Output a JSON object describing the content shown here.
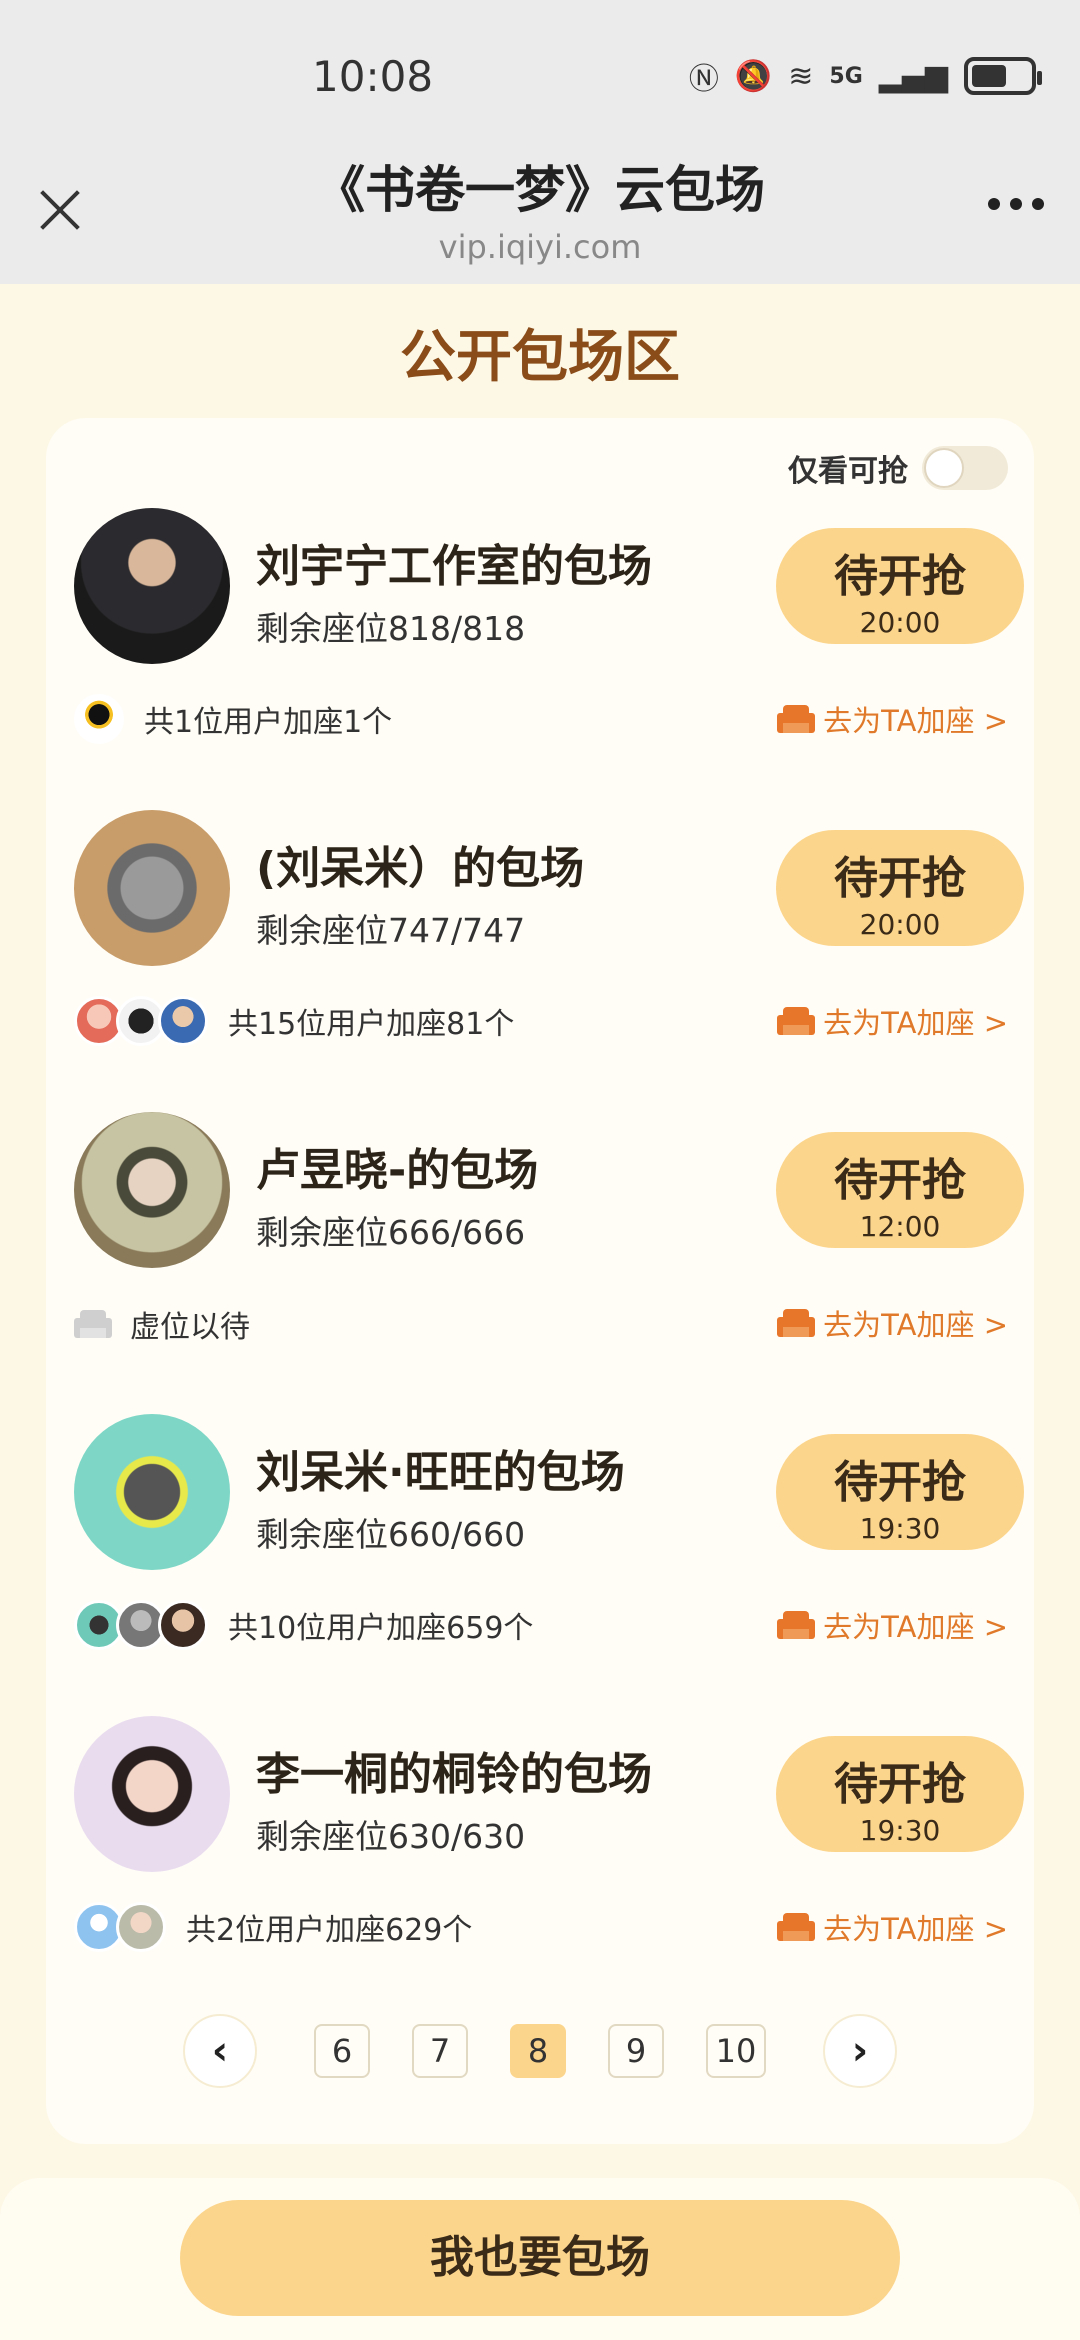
{
  "status_bar": {
    "time": "10:08",
    "signal_label": "5G"
  },
  "header": {
    "title": "《书卷一梦》云包场",
    "url": "vip.iqiyi.com"
  },
  "section_title": "公开包场区",
  "filter": {
    "label": "仅看可抢",
    "toggle_on": false
  },
  "entries": [
    {
      "title": "刘宇宁工作室的包场",
      "seats": "剩余座位818/818",
      "button": "待开抢",
      "time": "20:00",
      "users": "共1位用户加座1个",
      "seat_link": "去为TA加座 >"
    },
    {
      "title": "(刘呆米）的包场",
      "seats": "剩余座位747/747",
      "button": "待开抢",
      "time": "20:00",
      "users": "共15位用户加座81个",
      "seat_link": "去为TA加座 >"
    },
    {
      "title": "卢昱晓-的包场",
      "seats": "剩余座位666/666",
      "button": "待开抢",
      "time": "12:00",
      "users": "虚位以待",
      "seat_link": "去为TA加座 >"
    },
    {
      "title": "刘呆米·旺旺的包场",
      "seats": "剩余座位660/660",
      "button": "待开抢",
      "time": "19:30",
      "users": "共10位用户加座659个",
      "seat_link": "去为TA加座 >"
    },
    {
      "title": "李一桐的桐铃的包场",
      "seats": "剩余座位630/630",
      "button": "待开抢",
      "time": "19:30",
      "users": "共2位用户加座629个",
      "seat_link": "去为TA加座 >"
    }
  ],
  "pagination": {
    "prev": "‹",
    "next": "›",
    "pages": [
      "6",
      "7",
      "8",
      "9",
      "10"
    ],
    "current": "8"
  },
  "cta": "我也要包场",
  "colors": {
    "accent": "#fcd58c",
    "title_brown": "#8a4d1a",
    "link_orange": "#e07a2a"
  }
}
